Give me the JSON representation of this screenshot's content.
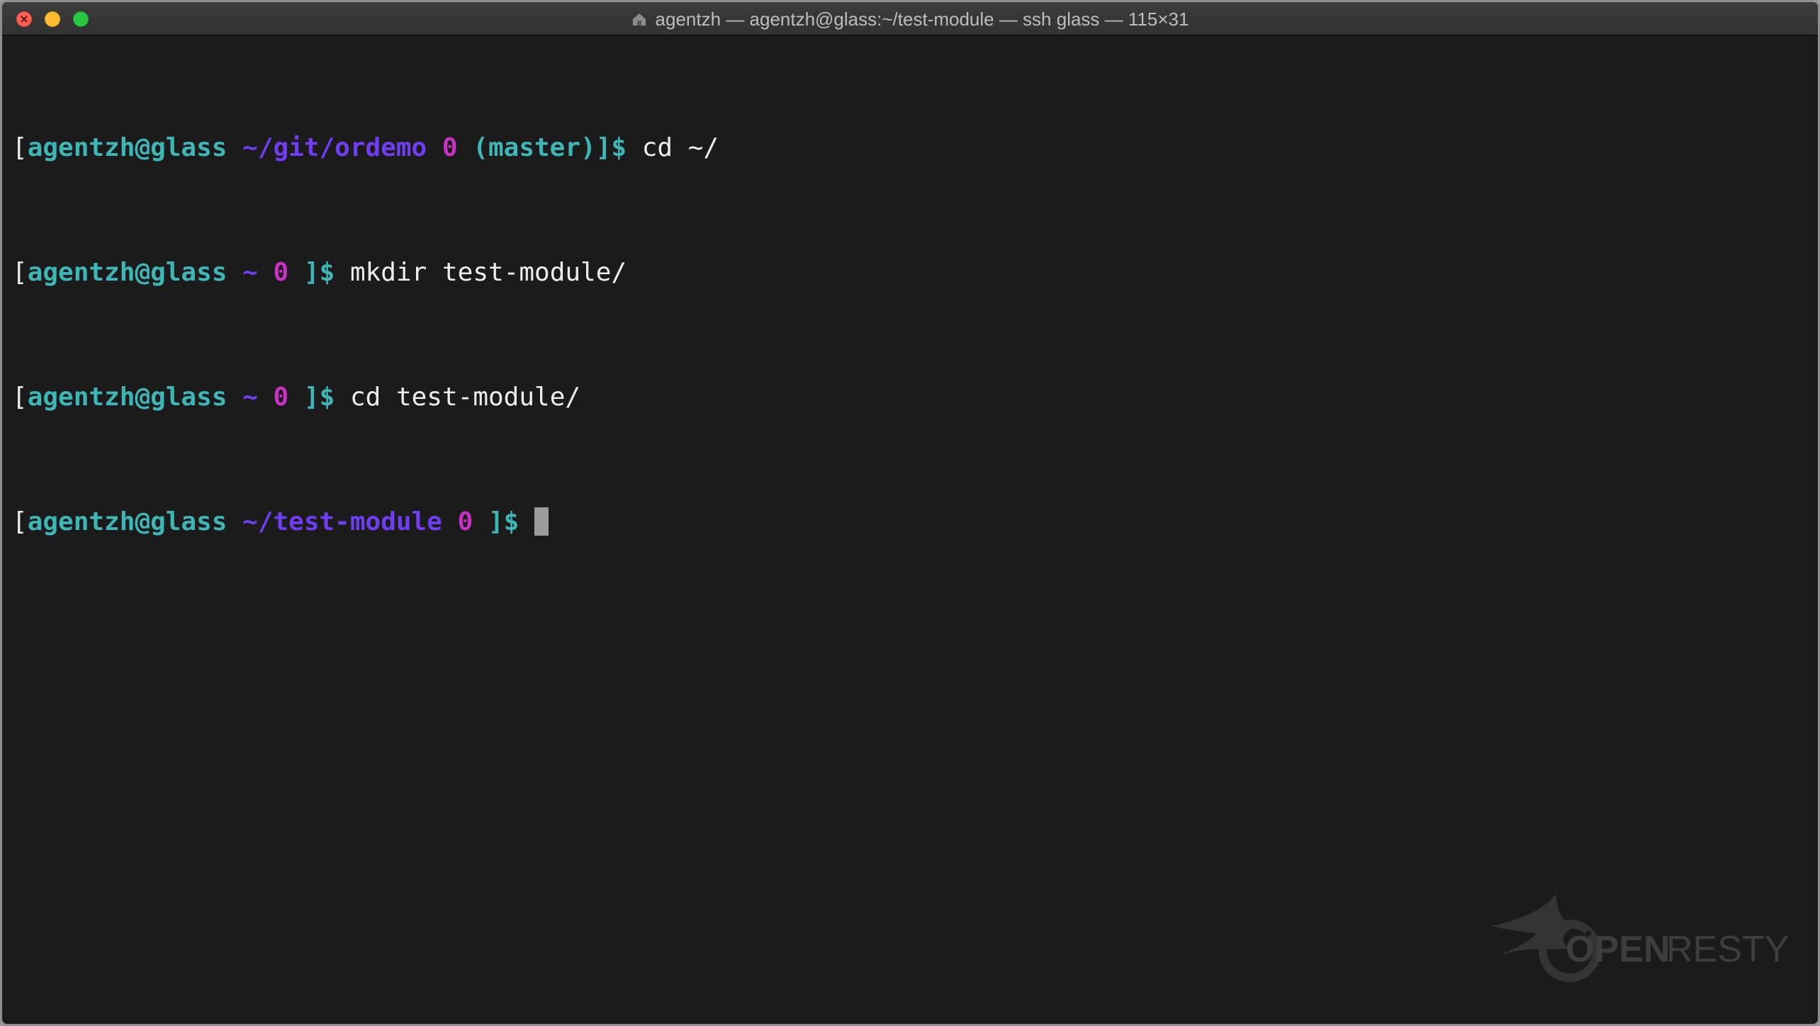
{
  "window": {
    "title": "agentzh — agentzh@glass:~/test-module — ssh glass — 115×31",
    "title_icon": "home-folder-icon",
    "traffic_lights": {
      "close": "#fd5f57",
      "minimize": "#febc2e",
      "zoom": "#28c840"
    }
  },
  "terminal": {
    "colors": {
      "background": "#1b1b1b",
      "user_host": "#3fb6b6",
      "path": "#6f3df2",
      "exit_code": "#c832c4",
      "branch": "#3fb6b6",
      "command": "#ededed"
    },
    "lines": [
      {
        "open_bracket": "[",
        "user_host": "agentzh@glass",
        "path": "~/git/ordemo",
        "exit_code": "0",
        "branch": "(master)",
        "close": "]$",
        "command": "cd ~/"
      },
      {
        "open_bracket": "[",
        "user_host": "agentzh@glass",
        "path": "~",
        "exit_code": "0",
        "close": "]$",
        "command": "mkdir test-module/"
      },
      {
        "open_bracket": "[",
        "user_host": "agentzh@glass",
        "path": "~",
        "exit_code": "0",
        "close": "]$",
        "command": "cd test-module/"
      },
      {
        "open_bracket": "[",
        "user_host": "agentzh@glass",
        "path": "~/test-module",
        "exit_code": "0",
        "close": "]$",
        "command": ""
      }
    ]
  },
  "watermark": {
    "logo": "openresty-bird-logo",
    "text_open": "OPEN",
    "text_resty": "RESTY"
  }
}
